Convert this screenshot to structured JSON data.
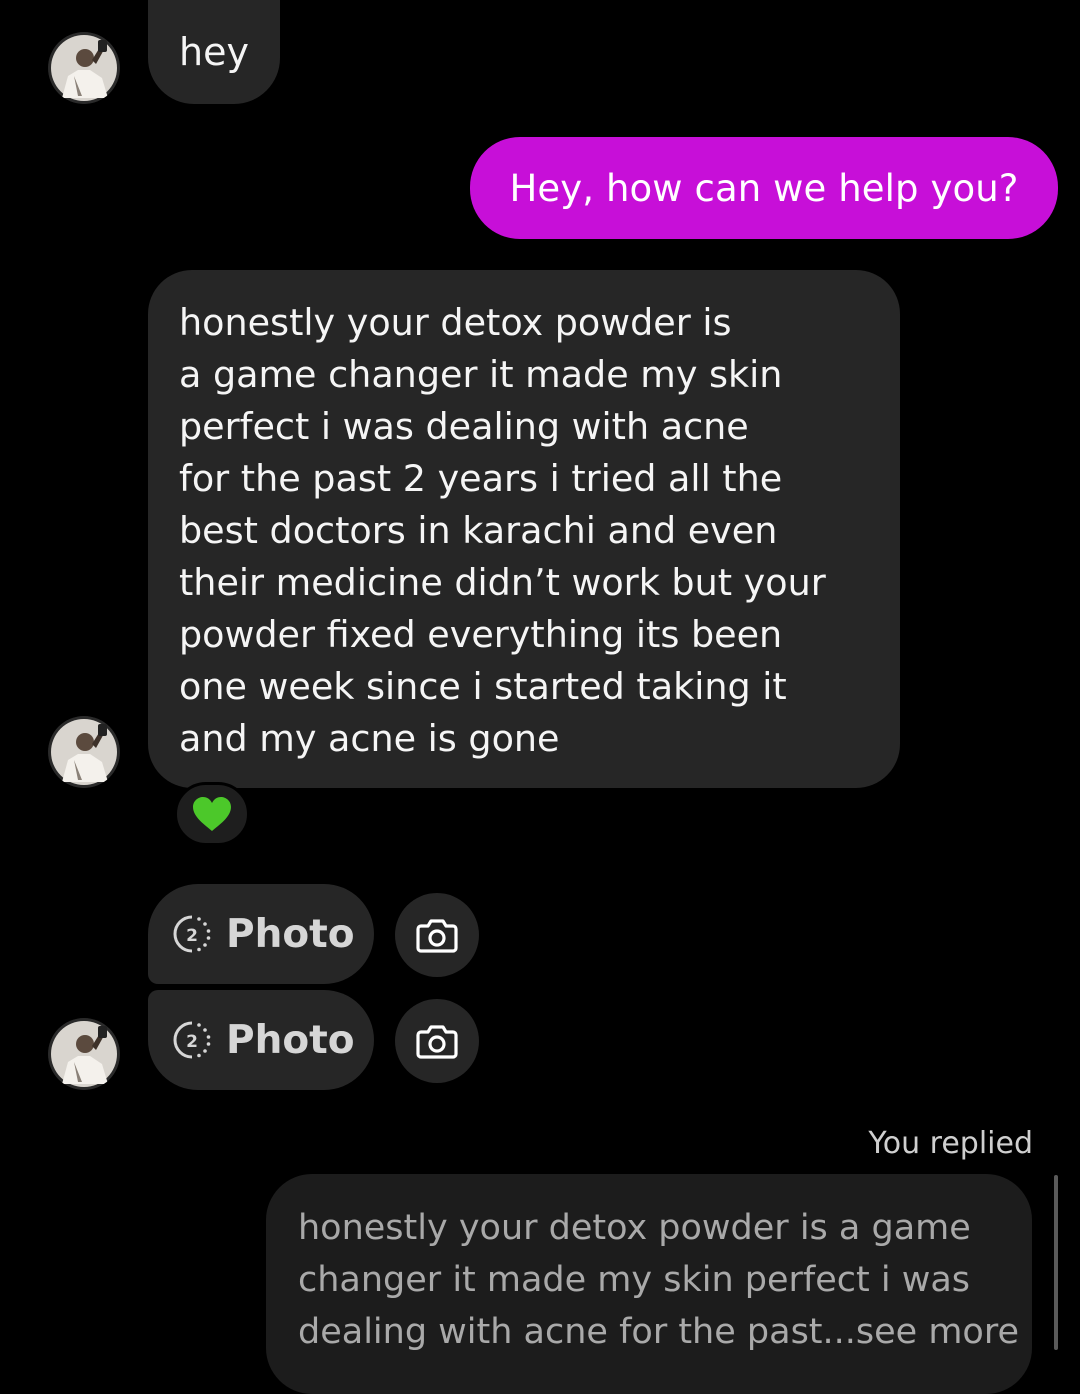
{
  "colors": {
    "background": "#000000",
    "incoming_bubble": "#262626",
    "outgoing_bubble": "#c70fd8",
    "heart": "#4cc82a"
  },
  "messages": {
    "hey": "hey",
    "help": "Hey, how can we help you?",
    "long_lines": [
      "honestly your detox powder is",
      "a game changer it made my skin",
      "perfect i was dealing with acne",
      "for the past 2 years i tried all the",
      "best doctors in karachi and even",
      "their medicine didn’t work but your",
      "powder fixed everything its been",
      "one week since i started taking it",
      "and my acne is gone"
    ],
    "reaction_emoji": "green-heart"
  },
  "photos": [
    {
      "label": "Photo",
      "view_count": "2"
    },
    {
      "label": "Photo",
      "view_count": "2"
    }
  ],
  "reply": {
    "header": "You replied",
    "lines": [
      "honestly your detox powder is a game",
      "changer it made my skin perfect i was",
      "dealing with acne for the past...see more"
    ]
  },
  "icons": {
    "avatar": "user-avatar",
    "timer": "view-once-timer-icon",
    "camera": "camera-icon",
    "heart": "green-heart-icon"
  }
}
